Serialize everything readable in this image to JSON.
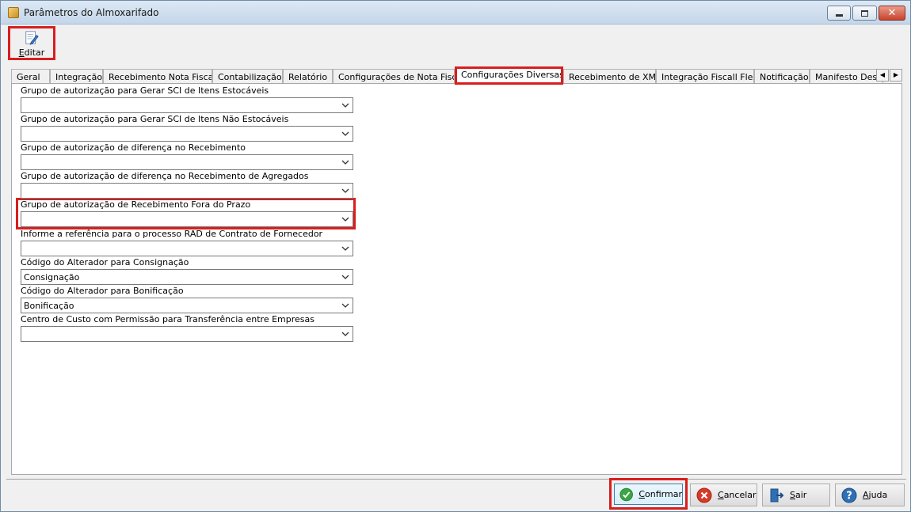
{
  "window": {
    "title": "Parâmetros do Almoxarifado",
    "controls": {
      "minimize": "minimize",
      "maximize": "maximize",
      "close": "✕"
    }
  },
  "toolbar": {
    "edit": {
      "underline": "E",
      "rest": "ditar",
      "icon": "edit-document-icon"
    }
  },
  "tabs": [
    "Geral",
    "Integração",
    "Recebimento Nota Fiscal",
    "Contabilização",
    "Relatório",
    "Configurações de Nota Fiscal",
    "Configurações Diversas",
    "Recebimento de XML",
    "Integração Fiscall Flex",
    "Notificação",
    "Manifesto Dest"
  ],
  "active_tab": "Configurações Diversas",
  "tab_scroll": {
    "left": "◀",
    "right": "▶"
  },
  "fields": [
    {
      "label": "Grupo de autorização para Gerar SCI de Itens Estocáveis",
      "value": ""
    },
    {
      "label": "Grupo de autorização para Gerar SCI de Itens Não Estocáveis",
      "value": ""
    },
    {
      "label": "Grupo de autorização de diferença no Recebimento",
      "value": ""
    },
    {
      "label": "Grupo de autorização de diferença no Recebimento de Agregados",
      "value": ""
    },
    {
      "label": "Grupo de autorização de Recebimento Fora do Prazo",
      "value": ""
    },
    {
      "label": "Informe a referência para o processo RAD de Contrato de Fornecedor",
      "value": ""
    },
    {
      "label": "Código do Alterador para Consignação",
      "value": "Consignação"
    },
    {
      "label": "Código do Alterador para Bonificação",
      "value": "Bonificação"
    },
    {
      "label": "Centro de Custo com Permissão para Transferência entre Empresas",
      "value": ""
    }
  ],
  "buttons": {
    "confirm": {
      "u": "C",
      "rest": "onfirmar",
      "icon": "check-circle-icon",
      "color": "#3aa544"
    },
    "cancel": {
      "u": "C",
      "rest": "ancelar",
      "icon": "cancel-circle-icon",
      "color": "#d83a2a"
    },
    "exit": {
      "u": "S",
      "rest": "air",
      "icon": "exit-door-icon",
      "color": "#2f6fb5"
    },
    "help": {
      "u": "A",
      "rest": "juda",
      "icon": "help-circle-icon",
      "color": "#2f6fb5"
    }
  },
  "highlight_color": "#d81e1e"
}
